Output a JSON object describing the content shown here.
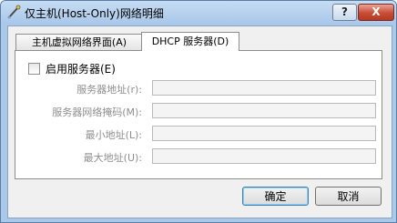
{
  "window": {
    "title": "仅主机(Host-Only)网络明细",
    "help_label": "?",
    "close_label": "X"
  },
  "tabs": [
    {
      "label": "主机虚拟网络界面(A)",
      "selected": false
    },
    {
      "label": "DHCP 服务器(D)",
      "selected": true
    }
  ],
  "dhcp": {
    "enable_label": "启用服务器(E)",
    "enabled": false,
    "fields": [
      {
        "label": "服务器地址(r):",
        "value": ""
      },
      {
        "label": "服务器网络掩码(M):",
        "value": ""
      },
      {
        "label": "最小地址(L):",
        "value": ""
      },
      {
        "label": "最大地址(U):",
        "value": ""
      }
    ]
  },
  "buttons": {
    "ok_label": "确定",
    "cancel_label": "取消"
  },
  "colors": {
    "frame": "#aac8e8",
    "close_button": "#c94c35",
    "default_button_border": "#3c7fb1"
  }
}
